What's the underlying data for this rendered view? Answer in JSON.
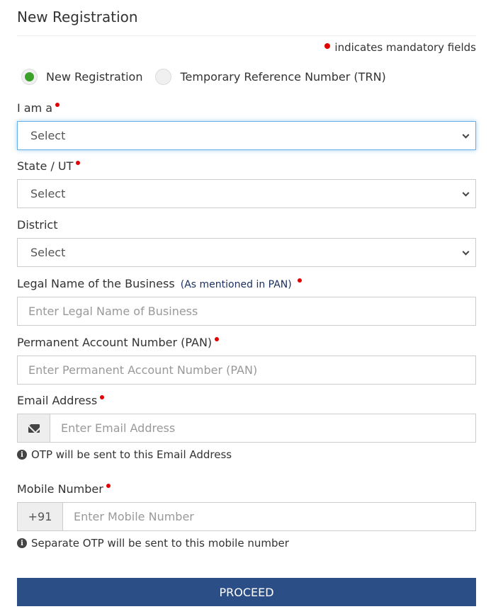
{
  "header": {
    "title": "New Registration"
  },
  "mandatory_note": "indicates mandatory fields",
  "registration_type": {
    "options": [
      {
        "label": "New Registration",
        "selected": true
      },
      {
        "label": "Temporary Reference Number (TRN)",
        "selected": false
      }
    ]
  },
  "fields": {
    "i_am_a": {
      "label": "I am a",
      "required": true,
      "value": "Select"
    },
    "state": {
      "label": "State / UT",
      "required": true,
      "value": "Select"
    },
    "district": {
      "label": "District",
      "required": false,
      "value": "Select"
    },
    "legal_name": {
      "label": "Legal Name of the Business",
      "hint": "(As mentioned in PAN)",
      "required": true,
      "placeholder": "Enter Legal Name of Business"
    },
    "pan": {
      "label": "Permanent Account Number (PAN)",
      "required": true,
      "placeholder": "Enter Permanent Account Number (PAN)"
    },
    "email": {
      "label": "Email Address",
      "required": true,
      "placeholder": "Enter Email Address",
      "icon": "envelope-icon",
      "help": "OTP will be sent to this Email Address"
    },
    "mobile": {
      "label": "Mobile Number",
      "required": true,
      "prefix": "+91",
      "placeholder": "Enter Mobile Number",
      "help": "Separate OTP will be sent to this mobile number"
    }
  },
  "actions": {
    "proceed_label": "PROCEED"
  },
  "colors": {
    "accent": "#2c4e86",
    "required_dot": "#e00000",
    "radio_selected": "#3aa129",
    "focus_border": "#66afe9"
  }
}
